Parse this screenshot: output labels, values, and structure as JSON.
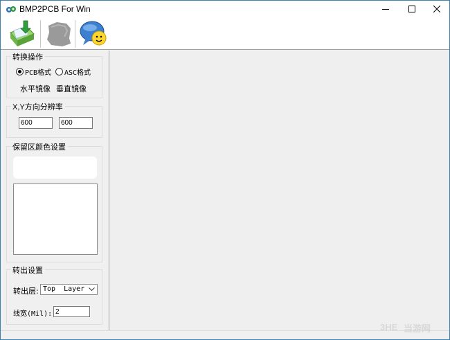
{
  "window": {
    "title": "BMP2PCB For Win"
  },
  "toolbar": {
    "buttons": [
      {
        "name": "open-bitmap",
        "icon": "folder-arrow-icon"
      },
      {
        "name": "convert",
        "icon": "gray-blob-icon"
      },
      {
        "name": "about",
        "icon": "smiley-chat-icon"
      }
    ]
  },
  "convert_group": {
    "title": "转换操作",
    "pcb_format_label": "PCB格式",
    "asc_format_label": "ASC格式",
    "selected_format": "PCB格式",
    "horizontal_mirror_label": "水平镜像",
    "vertical_mirror_label": "垂直镜像"
  },
  "resolution_group": {
    "title": "X,Y方向分辨率",
    "x_value": "600",
    "y_value": "600"
  },
  "color_group": {
    "title": "保留区颜色设置"
  },
  "output_group": {
    "title": "转出设置",
    "layer_label": "转出层:",
    "layer_value": "Top  Layer",
    "width_label": "线宽(Mil):",
    "width_value": "2"
  },
  "watermark": {
    "text": "当游网"
  },
  "colors": {
    "accent": "#3c7fb1",
    "panel": "#f0f0f0",
    "canvas": "#efefef"
  }
}
